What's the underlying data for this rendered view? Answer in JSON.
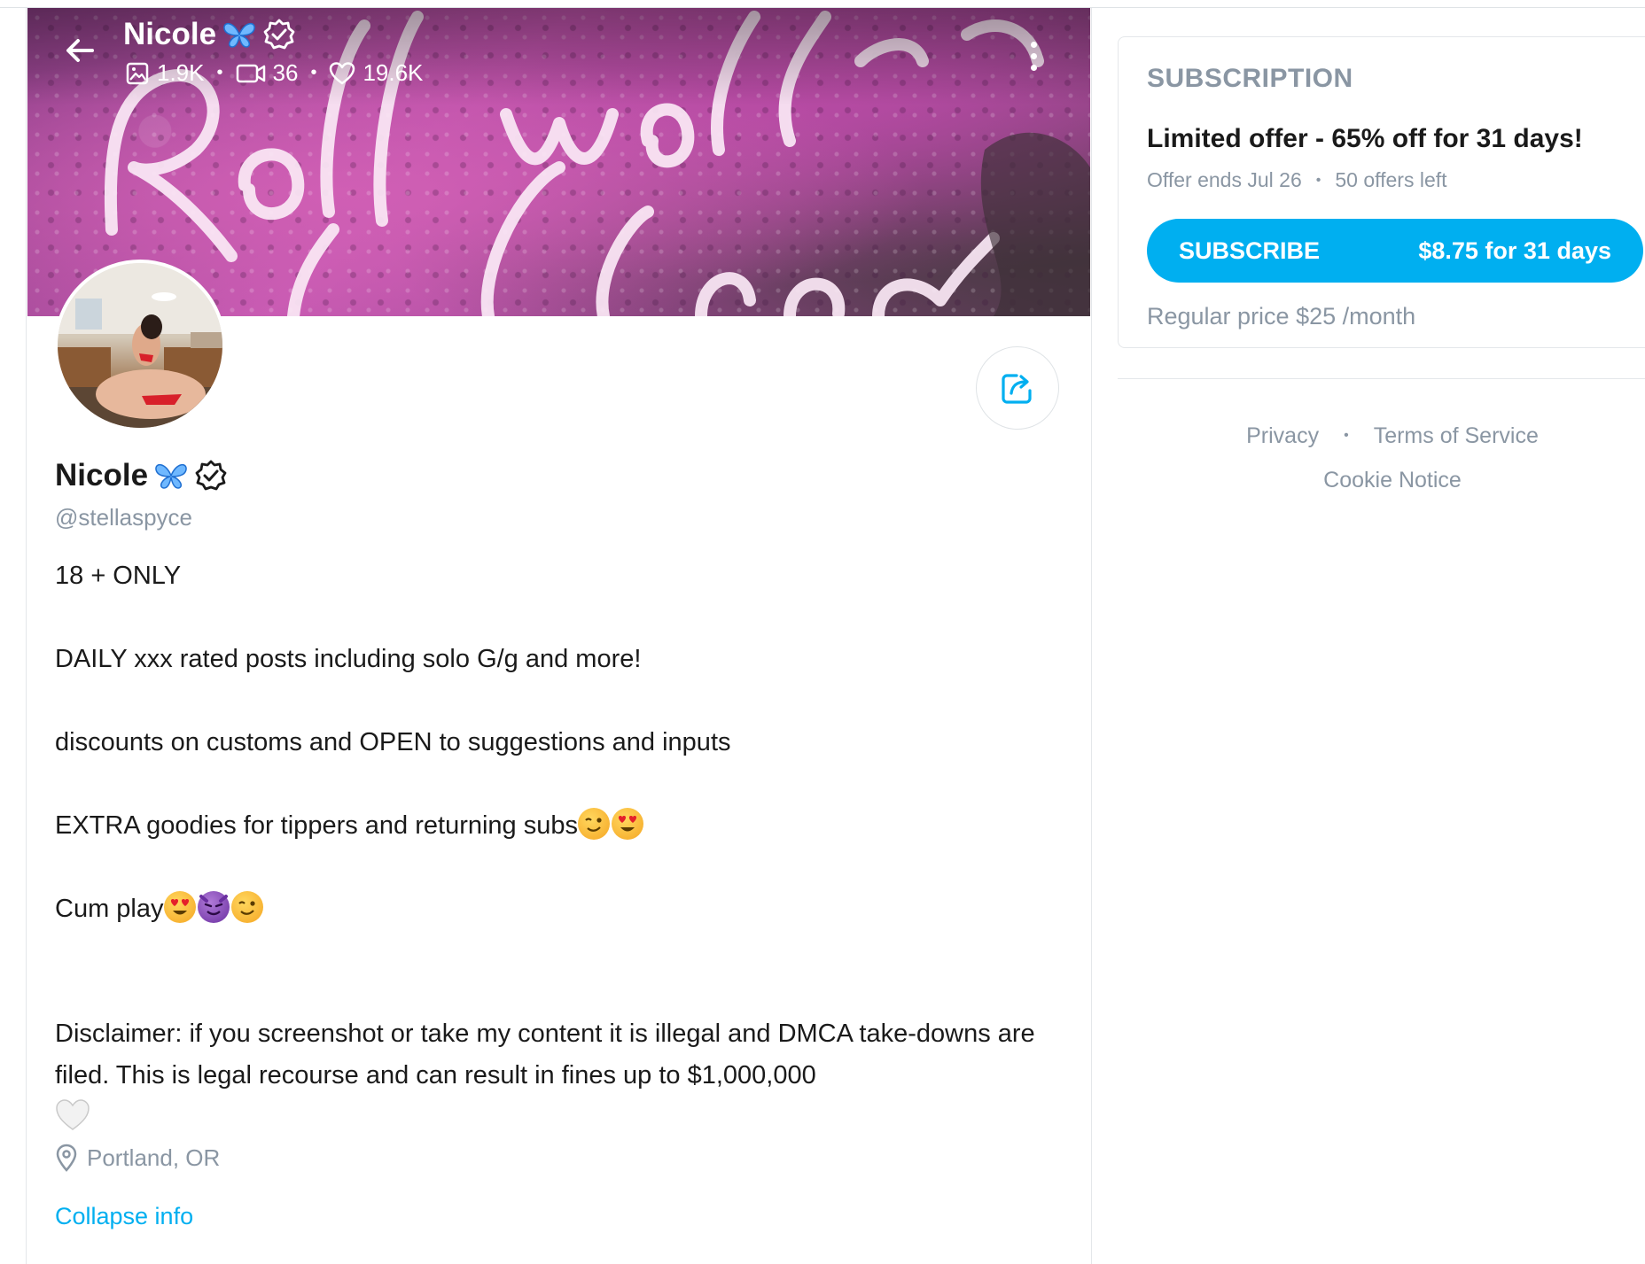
{
  "header": {
    "name": "Nicole",
    "stats": {
      "photos": "1.9K",
      "videos": "36",
      "likes": "19.6K"
    }
  },
  "profile": {
    "name": "Nicole",
    "handle": "@stellaspyce",
    "bio": [
      "18 + ONLY",
      "DAILY xxx rated posts including solo G/g and more!",
      "discounts on customs and OPEN to suggestions and inputs",
      "EXTRA goodies for tippers and returning subs",
      "Cum play",
      "Disclaimer: if you screenshot or take my content it is illegal and DMCA take-downs are filed. This is legal recourse and can result in fines up to $1,000,000"
    ],
    "location": "Portland, OR",
    "collapse_label": "Collapse info"
  },
  "subscription": {
    "title": "SUBSCRIPTION",
    "offer": "Limited offer - 65% off for 31 days!",
    "offer_ends": "Offer ends Jul 26",
    "offers_left": "50 offers left",
    "button_label": "SUBSCRIBE",
    "button_price": "$8.75 for 31 days",
    "regular_price": "Regular price $25 /month"
  },
  "footer": {
    "privacy": "Privacy",
    "terms": "Terms of Service",
    "cookie": "Cookie Notice"
  },
  "colors": {
    "accent": "#00aff0",
    "muted": "#8a96a3",
    "text": "#1a1a1a",
    "border": "#e4e7ea"
  },
  "icons": {
    "back": "arrow-left-icon",
    "photos": "image-icon",
    "videos": "video-icon",
    "likes": "heart-icon",
    "more": "more-vertical-icon",
    "verified": "verified-badge-icon",
    "butterfly": "butterfly-emoji",
    "share": "share-icon",
    "location": "map-pin-icon"
  }
}
